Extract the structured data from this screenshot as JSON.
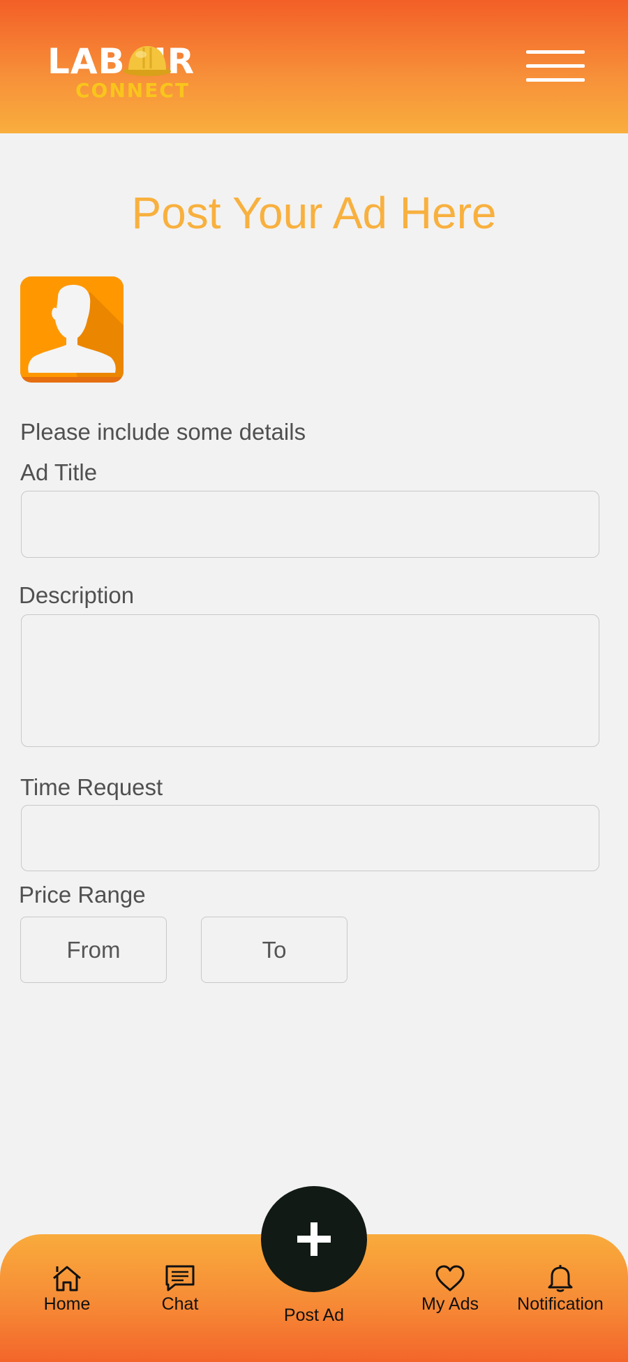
{
  "header": {
    "logo_top": "LAB  UR",
    "logo_bottom": "CONNECT",
    "menu_icon": "hamburger-menu-icon"
  },
  "page": {
    "title": "Post Your Ad Here",
    "avatar_icon": "user-silhouette-icon",
    "hint": "Please include some details"
  },
  "form": {
    "ad_title_label": "Ad Title",
    "ad_title_value": "",
    "description_label": "Description",
    "description_value": "",
    "time_request_label": "Time Request",
    "time_request_value": "",
    "price_range_label": "Price Range",
    "price_from_placeholder": "From",
    "price_to_placeholder": "To"
  },
  "nav": {
    "items": [
      {
        "label": "Home",
        "icon": "home-icon"
      },
      {
        "label": "Chat",
        "icon": "chat-icon"
      },
      {
        "label": "Post Ad",
        "icon": "plus-icon"
      },
      {
        "label": "My Ads",
        "icon": "heart-icon"
      },
      {
        "label": "Notification",
        "icon": "bell-icon"
      }
    ]
  },
  "colors": {
    "header_top": "#f35f27",
    "header_bottom": "#f9ae3d",
    "title": "#f8b03e",
    "avatar_bg": "#ff9800",
    "logo_yellow": "#f9c51c",
    "fab": "#111a14"
  }
}
